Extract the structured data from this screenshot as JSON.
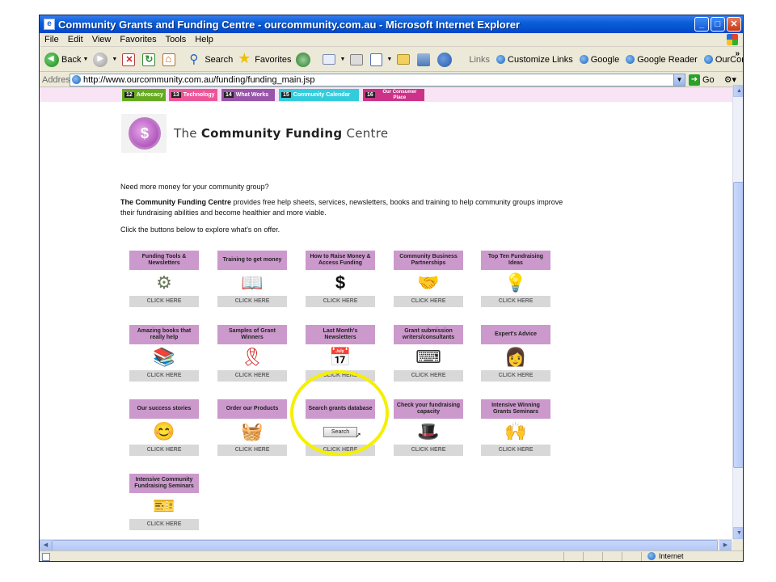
{
  "window": {
    "title": "Community Grants and Funding Centre - ourcommunity.com.au - Microsoft Internet Explorer",
    "buttons": {
      "minimize": "_",
      "maximize": "□",
      "close": "✕"
    }
  },
  "menu": [
    "File",
    "Edit",
    "View",
    "Favorites",
    "Tools",
    "Help"
  ],
  "toolbar": {
    "back": "Back",
    "search": "Search",
    "favorites": "Favorites",
    "links_label": "Links",
    "links": [
      "Customize Links",
      "Google",
      "Google Reader",
      "OurCommunity Grant Search"
    ]
  },
  "address": {
    "label": "Address",
    "url": "http://www.ourcommunity.com.au/funding/funding_main.jsp",
    "go": "Go"
  },
  "nav_tabs": [
    {
      "num": "12",
      "label": "Advocacy",
      "color": "#66aa22"
    },
    {
      "num": "13",
      "label": "Technology",
      "color": "#ee5599"
    },
    {
      "num": "14",
      "label": "What Works",
      "color": "#9955aa"
    },
    {
      "num": "15",
      "label": "Community Calendar",
      "color": "#33ccdd"
    },
    {
      "num": "16",
      "label": "Our Consumer Place",
      "color": "#cc3388"
    }
  ],
  "logo": {
    "glyph": "$",
    "text_prefix": "The ",
    "text_bold": "Community Funding",
    "text_suffix": " Centre"
  },
  "intro": {
    "line1": "Need more money for your community group?",
    "line2_bold": "The Community Funding Centre",
    "line2_rest": " provides free help sheets, services, newsletters, books and training to help community groups improve their fundraising abilities and become healthier and more viable.",
    "line3": "Click the buttons below to explore what's on offer."
  },
  "cards": [
    {
      "title": "Funding Tools & Newsletters",
      "icon": "toolbox-icon",
      "glyph": "⚙",
      "glyph_color": "#6a7a5a",
      "cta": "CLICK HERE"
    },
    {
      "title": "Training to get money",
      "icon": "book-icon",
      "glyph": "📖",
      "glyph_color": "#c08040",
      "cta": "CLICK HERE"
    },
    {
      "title": "How to Raise Money & Access Funding",
      "icon": "dollar-icon",
      "glyph": "$",
      "glyph_color": "#111111",
      "cta": "CLICK HERE"
    },
    {
      "title": "Community Business Partnerships",
      "icon": "handshake-icon",
      "glyph": "🤝",
      "glyph_color": "#6a5a9a",
      "cta": "CLICK HERE"
    },
    {
      "title": "Top Ten Fundraising Ideas",
      "icon": "lightbulb-icon",
      "glyph": "💡",
      "glyph_color": "#e8c020",
      "cta": "CLICK HERE"
    },
    {
      "title": "Amazing books that really help",
      "icon": "books-icon",
      "glyph": "📚",
      "glyph_color": "#a04020",
      "cta": "CLICK HERE"
    },
    {
      "title": "Samples of Grant Winners",
      "icon": "ribbon-icon",
      "glyph": "🎗",
      "glyph_color": "#d02020",
      "cta": "CLICK HERE"
    },
    {
      "title": "Last Month's Newsletters",
      "icon": "calendar-icon",
      "glyph": "📅",
      "glyph_color": "#e86090",
      "cta": "CLICK HERE"
    },
    {
      "title": "Grant submission writers/consultants",
      "icon": "typewriter-icon",
      "glyph": "⌨",
      "glyph_color": "#333333",
      "cta": "CLICK HERE"
    },
    {
      "title": "Expert's Advice",
      "icon": "expert-icon",
      "glyph": "👩",
      "glyph_color": "#d08020",
      "cta": "CLICK HERE"
    },
    {
      "title": "Our success stories",
      "icon": "success-icon",
      "glyph": "😊",
      "glyph_color": "#d09040",
      "cta": "CLICK HERE"
    },
    {
      "title": "Order our Products",
      "icon": "basket-icon",
      "glyph": "🧺",
      "glyph_color": "#c04020",
      "cta": "CLICK HERE"
    },
    {
      "title": "Search grants database",
      "icon": "search-button-icon",
      "search_label": "Search",
      "cta": "CLICK HERE"
    },
    {
      "title": "Check your fundraising capacity",
      "icon": "top-hat-icon",
      "glyph": "🎩",
      "glyph_color": "#222222",
      "cta": "CLICK HERE"
    },
    {
      "title": "Intensive Winning Grants Seminars",
      "icon": "seminar-icon",
      "glyph": "🙌",
      "glyph_color": "#8a6a4a",
      "cta": "CLICK HERE"
    },
    {
      "title": "Intensive Community Fundraising Seminars",
      "icon": "fundraising-seminar-icon",
      "glyph": "🎫",
      "glyph_color": "#4a6a8a",
      "cta": "CLICK HERE"
    }
  ],
  "status": {
    "zone": "Internet"
  },
  "colors": {
    "card_header": "#cc99cc",
    "card_footer": "#d8d8d8",
    "highlight": "#f4f000",
    "pinkbar": "#f8e4f4"
  }
}
